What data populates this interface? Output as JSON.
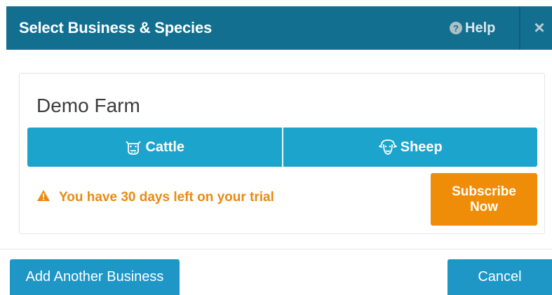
{
  "dialog": {
    "title": "Select Business & Species",
    "help_label": "Help",
    "help_icon": "question-circle-icon",
    "close_icon": "close-icon",
    "close_glyph": "×"
  },
  "business": {
    "name": "Demo Farm",
    "species": [
      {
        "label": "Cattle",
        "icon": "cattle-icon"
      },
      {
        "label": "Sheep",
        "icon": "sheep-icon"
      }
    ],
    "trial_warning": "You have 30 days left on your trial",
    "warning_icon": "warning-triangle-icon",
    "subscribe_line1": "Subscribe",
    "subscribe_line2": "Now"
  },
  "footer": {
    "add_business_label": "Add Another Business",
    "cancel_label": "Cancel"
  },
  "colors": {
    "header": "#136f8f",
    "primary": "#1da4cc",
    "footer_button": "#1e96c6",
    "warning": "#ea8a12",
    "subscribe": "#f08d08"
  }
}
